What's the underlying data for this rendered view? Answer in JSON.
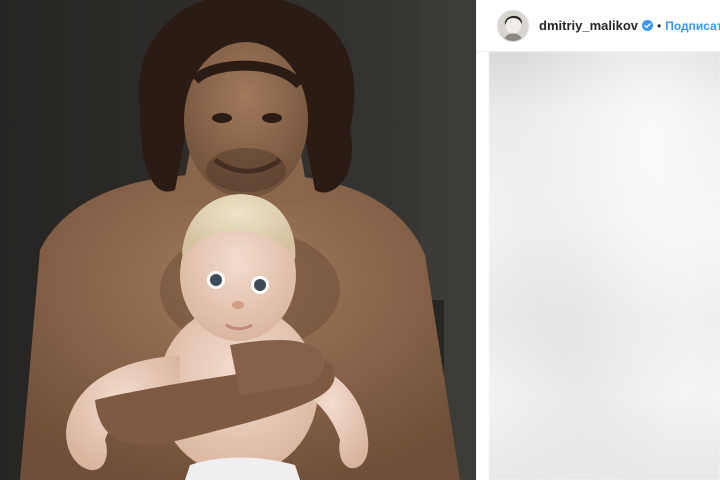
{
  "post": {
    "author": {
      "username": "dmitriy_malikov",
      "verified": true,
      "avatar_icon": "profile-avatar"
    },
    "separator": "•",
    "follow_label": "Подписаться",
    "photo_icon": "photo-father-with-baby"
  },
  "colors": {
    "follow": "#3897f0",
    "verified_badge": "#3897f0",
    "username": "#262626"
  }
}
